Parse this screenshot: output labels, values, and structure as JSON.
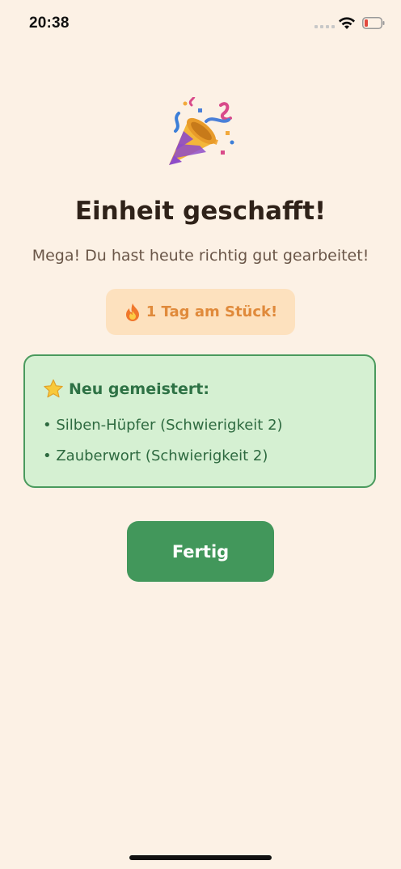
{
  "status_bar": {
    "time": "20:38",
    "battery_color": "#e24a3f"
  },
  "hero": {
    "icon": "party-popper-icon"
  },
  "title": "Einheit geschafft!",
  "subtitle": "Mega! Du hast heute richtig gut gearbeitet!",
  "streak": {
    "icon": "fire-icon",
    "label": "1 Tag am Stück!"
  },
  "mastered": {
    "icon": "star-icon",
    "title": "Neu gemeistert:",
    "items": [
      "• Silben-Hüpfer (Schwierigkeit 2)",
      "• Zauberwort (Schwierigkeit 2)"
    ]
  },
  "done_button": {
    "label": "Fertig"
  },
  "colors": {
    "background": "#fcf1e5",
    "accent_green": "#42975b",
    "streak_orange": "#e08a3b",
    "card_green": "#d5f0d2"
  }
}
